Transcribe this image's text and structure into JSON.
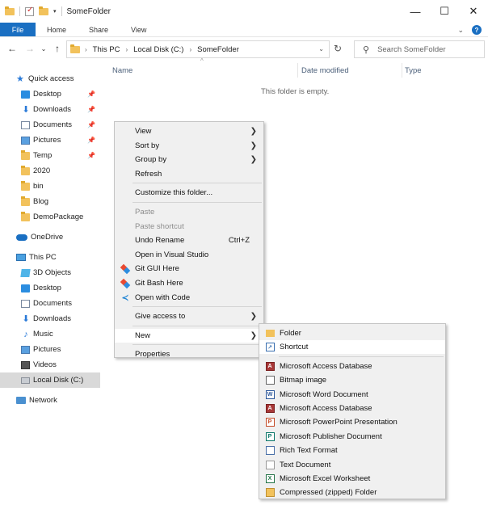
{
  "window": {
    "title": "SomeFolder",
    "minimize": "—",
    "maximize": "☐",
    "close": "✕"
  },
  "ribbon": {
    "file": "File",
    "tabs": [
      "Home",
      "Share",
      "View"
    ]
  },
  "address": {
    "crumbs": [
      "This PC",
      "Local Disk (C:)",
      "SomeFolder"
    ],
    "search_placeholder": "Search SomeFolder"
  },
  "nav_pane": {
    "quick_access": "Quick access",
    "quick_items": [
      {
        "label": "Desktop",
        "icon": "desktop-icon",
        "pinned": true
      },
      {
        "label": "Downloads",
        "icon": "download-icon",
        "pinned": true
      },
      {
        "label": "Documents",
        "icon": "documents-icon",
        "pinned": true
      },
      {
        "label": "Pictures",
        "icon": "pictures-icon",
        "pinned": true
      },
      {
        "label": "Temp",
        "icon": "folder-icon",
        "pinned": true
      },
      {
        "label": "2020",
        "icon": "folder-icon",
        "pinned": false
      },
      {
        "label": "bin",
        "icon": "folder-icon",
        "pinned": false
      },
      {
        "label": "Blog",
        "icon": "folder-icon",
        "pinned": false
      },
      {
        "label": "DemoPackage",
        "icon": "folder-icon",
        "pinned": false
      }
    ],
    "onedrive": "OneDrive",
    "this_pc": "This PC",
    "pc_items": [
      {
        "label": "3D Objects",
        "icon": "3d-objects-icon"
      },
      {
        "label": "Desktop",
        "icon": "desktop-icon"
      },
      {
        "label": "Documents",
        "icon": "documents-icon"
      },
      {
        "label": "Downloads",
        "icon": "download-icon"
      },
      {
        "label": "Music",
        "icon": "music-icon"
      },
      {
        "label": "Pictures",
        "icon": "pictures-icon"
      },
      {
        "label": "Videos",
        "icon": "videos-icon"
      },
      {
        "label": "Local Disk (C:)",
        "icon": "drive-icon",
        "selected": true
      }
    ],
    "network": "Network"
  },
  "columns": [
    "Name",
    "Date modified",
    "Type"
  ],
  "empty_message": "This folder is empty.",
  "context_menu": {
    "groups": [
      [
        {
          "label": "View",
          "submenu": true
        },
        {
          "label": "Sort by",
          "submenu": true
        },
        {
          "label": "Group by",
          "submenu": true
        },
        {
          "label": "Refresh"
        }
      ],
      [
        {
          "label": "Customize this folder..."
        }
      ],
      [
        {
          "label": "Paste",
          "disabled": true
        },
        {
          "label": "Paste shortcut",
          "disabled": true
        },
        {
          "label": "Undo Rename",
          "shortcut": "Ctrl+Z"
        },
        {
          "label": "Open in Visual Studio"
        },
        {
          "label": "Git GUI Here",
          "icon": "git"
        },
        {
          "label": "Git Bash Here",
          "icon": "git"
        },
        {
          "label": "Open with Code",
          "icon": "vscode"
        }
      ],
      [
        {
          "label": "Give access to",
          "submenu": true
        }
      ],
      [
        {
          "label": "New",
          "submenu": true,
          "highlighted": true
        }
      ],
      [
        {
          "label": "Properties"
        }
      ]
    ]
  },
  "new_submenu": {
    "groups": [
      [
        {
          "label": "Folder",
          "icon": "fold"
        },
        {
          "label": "Shortcut",
          "icon": "short",
          "highlighted": true
        }
      ],
      [
        {
          "label": "Microsoft Access Database",
          "icon": "access",
          "glyph": "A"
        },
        {
          "label": "Bitmap image",
          "icon": "bmp",
          "glyph": ""
        },
        {
          "label": "Microsoft Word Document",
          "icon": "word",
          "glyph": "W"
        },
        {
          "label": "Microsoft Access Database",
          "icon": "access",
          "glyph": "A"
        },
        {
          "label": "Microsoft PowerPoint Presentation",
          "icon": "ppt",
          "glyph": "P"
        },
        {
          "label": "Microsoft Publisher Document",
          "icon": "pub",
          "glyph": "P"
        },
        {
          "label": "Rich Text Format",
          "icon": "rtf",
          "glyph": ""
        },
        {
          "label": "Text Document",
          "icon": "txt",
          "glyph": ""
        },
        {
          "label": "Microsoft Excel Worksheet",
          "icon": "excel",
          "glyph": "X"
        },
        {
          "label": "Compressed (zipped) Folder",
          "icon": "zip",
          "glyph": ""
        }
      ]
    ]
  }
}
